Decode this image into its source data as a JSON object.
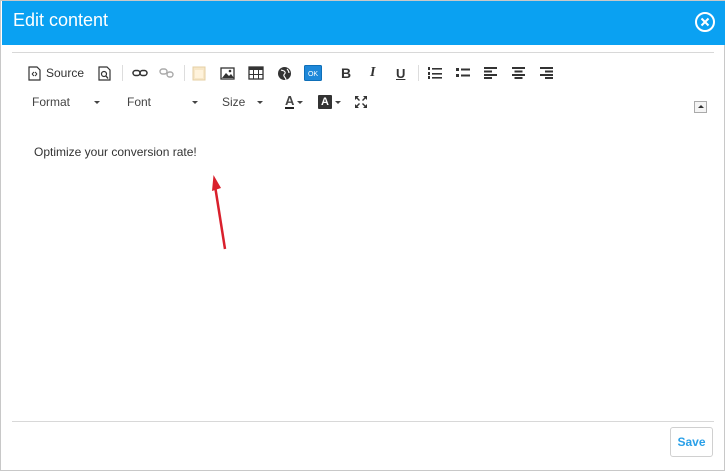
{
  "dialog": {
    "title": "Edit content",
    "accent_color": "#0aa1f2"
  },
  "toolbar": {
    "source_label": "Source",
    "icons": [
      "source-icon",
      "preview-icon",
      "link-icon",
      "unlink-icon",
      "paste-icon",
      "image-icon",
      "table-icon",
      "globe-icon",
      "ok-button-icon",
      "bold-icon",
      "italic-icon",
      "underline-icon",
      "numbered-list-icon",
      "bulleted-list-icon",
      "align-left-icon",
      "align-center-icon",
      "align-right-icon"
    ],
    "ok_label": "OK",
    "bold_label": "B",
    "italic_label": "I",
    "underline_label": "U",
    "format_label": "Format",
    "font_label": "Font",
    "size_label": "Size",
    "text_color_label": "A",
    "bg_color_label": "A"
  },
  "content": {
    "text": "Optimize your conversion rate!",
    "annotation_color": "#d9202c"
  },
  "footer": {
    "save_label": "Save"
  }
}
